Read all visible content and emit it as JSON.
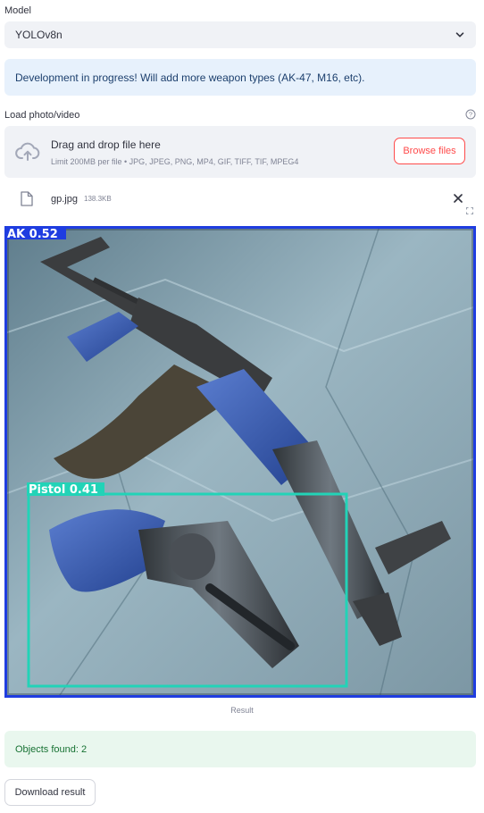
{
  "model": {
    "label": "Model",
    "selected": "YOLOv8n",
    "icon": "chevron-down-icon"
  },
  "info_message": "Development in progress! Will add more weapon types (AK-47, M16, etc).",
  "uploader": {
    "label": "Load photo/video",
    "title": "Drag and drop file here",
    "subtitle": "Limit 200MB per file • JPG, JPEG, PNG, MP4, GIF, TIFF, TIF, MPEG4",
    "browse_label": "Browse files",
    "icon": "cloud-upload-icon",
    "help_icon": "question-circle-icon"
  },
  "file": {
    "name": "gp.jpg",
    "size": "138.3KB",
    "icon": "file-icon",
    "remove_icon": "close-icon"
  },
  "result": {
    "detections": [
      {
        "label": "AK 0.52",
        "color": "#1f3de0"
      },
      {
        "label": "Pistol 0.41",
        "color": "#22d3b7"
      }
    ],
    "caption": "Result",
    "fullscreen_icon": "fullscreen-icon"
  },
  "status": "Objects found: 2",
  "download_label": "Download result",
  "colors": {
    "accent": "#ff4b4b",
    "info_bg": "#e7f1fc",
    "success_bg": "#e9f7ee",
    "widget_bg": "#f0f2f6"
  }
}
